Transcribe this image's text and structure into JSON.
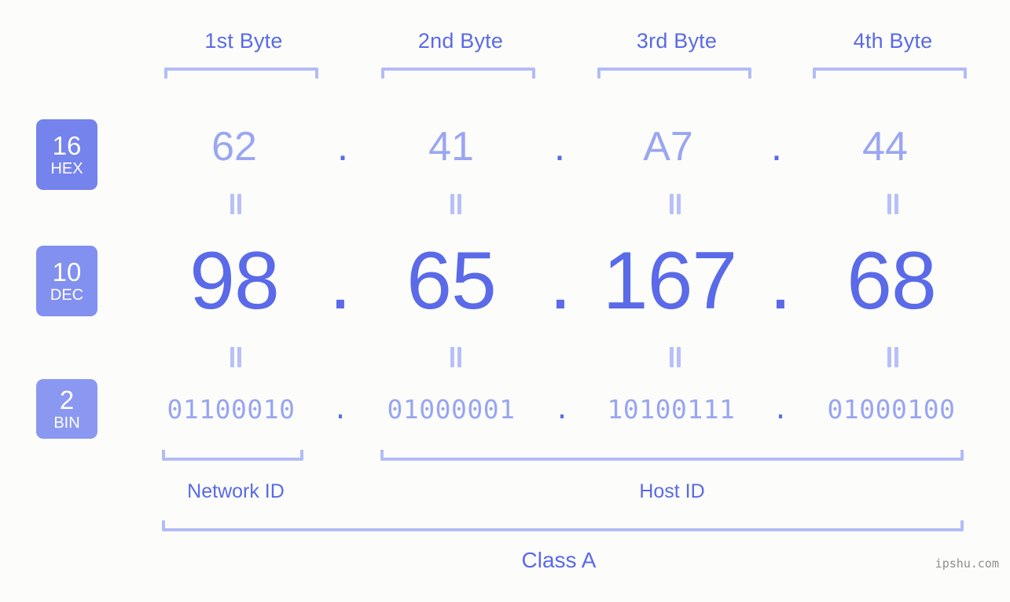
{
  "meta": {
    "background_color": "#fcfdfa",
    "accent_color": "#5a6ae8",
    "light_accent_color": "#9aa6f2",
    "bracket_color": "#b3bcf7",
    "badge_hex_color": "#7583ec",
    "badge_dec_color": "#8290ef",
    "badge_bin_color": "#8b98f2",
    "watermark_color": "#8d8d8d"
  },
  "header": {
    "byte_labels": [
      "1st Byte",
      "2nd Byte",
      "3rd Byte",
      "4th Byte"
    ]
  },
  "rows": [
    {
      "key": "hex",
      "badge_number": "16",
      "badge_abbr": "HEX",
      "values": [
        "62",
        "41",
        "A7",
        "44"
      ],
      "separator": "."
    },
    {
      "key": "dec",
      "badge_number": "10",
      "badge_abbr": "DEC",
      "values": [
        "98",
        "65",
        "167",
        "68"
      ],
      "separator": "."
    },
    {
      "key": "bin",
      "badge_number": "2",
      "badge_abbr": "BIN",
      "values": [
        "01100010",
        "01000001",
        "10100111",
        "01000100"
      ],
      "separator": "."
    }
  ],
  "equals_symbol": "=",
  "sections": {
    "network_id": "Network ID",
    "host_id": "Host ID"
  },
  "class": {
    "label": "Class A"
  },
  "watermark": {
    "text": "ipshu.com"
  }
}
